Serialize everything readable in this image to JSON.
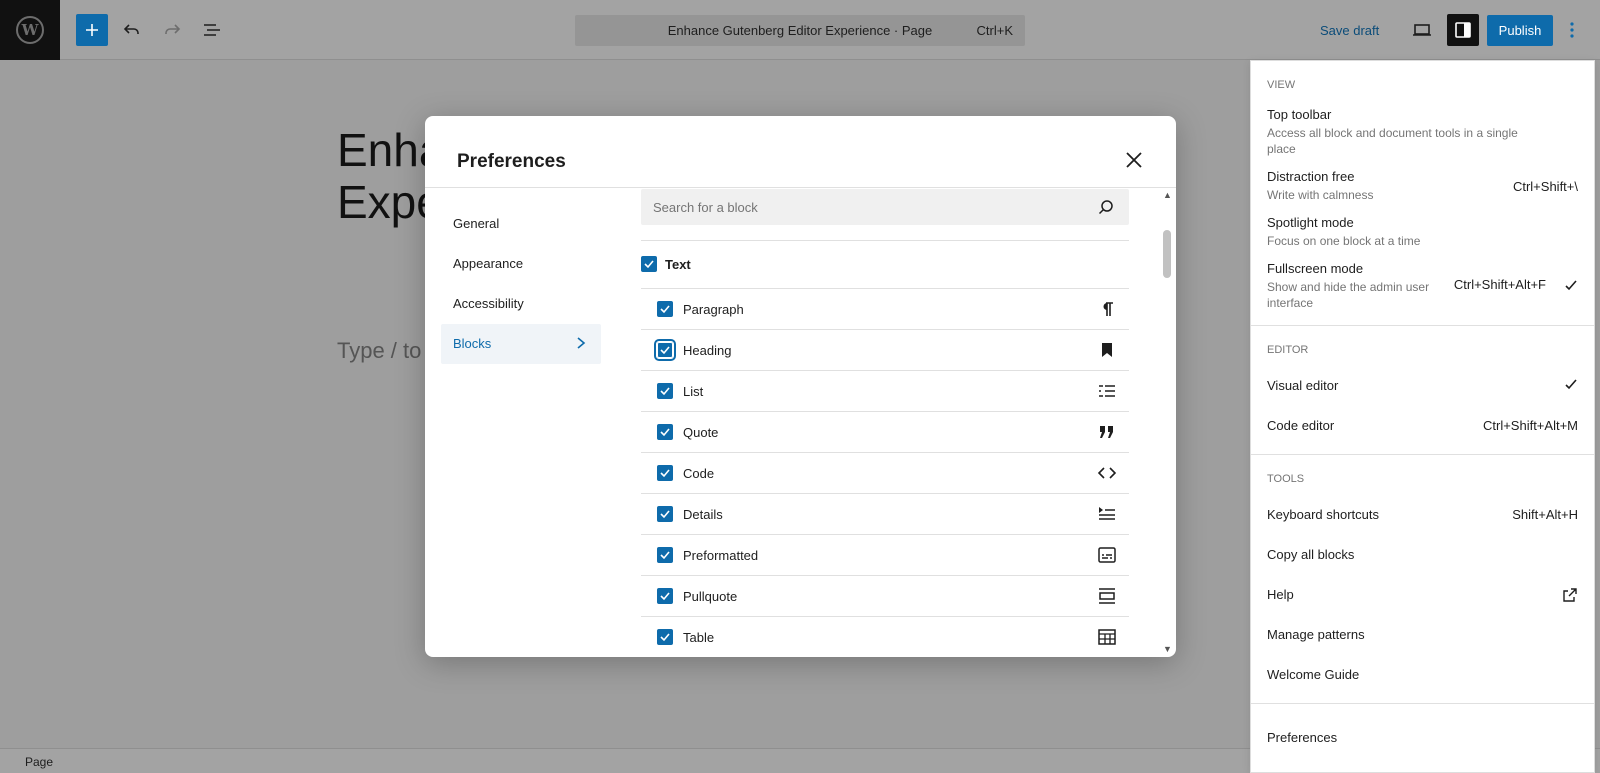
{
  "toolbar": {
    "document_title": "Enhance Gutenberg Editor Experience · Page",
    "command_shortcut": "Ctrl+K",
    "save_draft_label": "Save draft",
    "publish_label": "Publish"
  },
  "editor": {
    "title_line1": "Enha",
    "title_line2": "Expe",
    "placeholder": "Type / to"
  },
  "status_bar": {
    "label": "Page"
  },
  "preferences": {
    "title": "Preferences",
    "nav": [
      {
        "label": "General"
      },
      {
        "label": "Appearance"
      },
      {
        "label": "Accessibility"
      },
      {
        "label": "Blocks"
      }
    ],
    "active_nav": "Blocks",
    "search_placeholder": "Search for a block",
    "category": "Text",
    "blocks": [
      {
        "label": "Paragraph",
        "icon": "paragraph-icon",
        "checked": true
      },
      {
        "label": "Heading",
        "icon": "heading-bookmark-icon",
        "checked": true
      },
      {
        "label": "List",
        "icon": "list-icon",
        "checked": true
      },
      {
        "label": "Quote",
        "icon": "quote-icon",
        "checked": true
      },
      {
        "label": "Code",
        "icon": "code-icon",
        "checked": true
      },
      {
        "label": "Details",
        "icon": "details-icon",
        "checked": true
      },
      {
        "label": "Preformatted",
        "icon": "preformatted-icon",
        "checked": true
      },
      {
        "label": "Pullquote",
        "icon": "pullquote-icon",
        "checked": true
      },
      {
        "label": "Table",
        "icon": "table-icon",
        "checked": true
      }
    ]
  },
  "options_menu": {
    "view": {
      "title": "View",
      "items": [
        {
          "label": "Top toolbar",
          "desc": "Access all block and document tools in a single place",
          "shortcut": "",
          "checked": false
        },
        {
          "label": "Distraction free",
          "desc": "Write with calmness",
          "shortcut": "Ctrl+Shift+\\",
          "checked": false
        },
        {
          "label": "Spotlight mode",
          "desc": "Focus on one block at a time",
          "shortcut": "",
          "checked": false
        },
        {
          "label": "Fullscreen mode",
          "desc": "Show and hide the admin user interface",
          "shortcut": "Ctrl+Shift+Alt+F",
          "checked": true
        }
      ]
    },
    "editor": {
      "title": "Editor",
      "items": [
        {
          "label": "Visual editor",
          "shortcut": "",
          "checked": true
        },
        {
          "label": "Code editor",
          "shortcut": "Ctrl+Shift+Alt+M",
          "checked": false
        }
      ]
    },
    "tools": {
      "title": "Tools",
      "items": [
        {
          "label": "Keyboard shortcuts",
          "shortcut": "Shift+Alt+H"
        },
        {
          "label": "Copy all blocks",
          "shortcut": ""
        },
        {
          "label": "Help",
          "shortcut": ""
        },
        {
          "label": "Manage patterns",
          "shortcut": ""
        },
        {
          "label": "Welcome Guide",
          "shortcut": ""
        }
      ]
    },
    "preferences_label": "Preferences"
  }
}
